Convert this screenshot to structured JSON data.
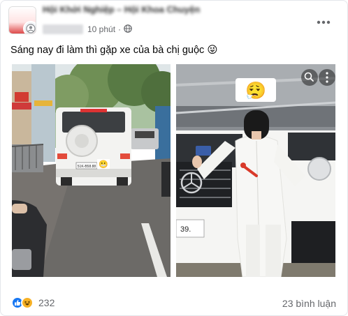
{
  "post": {
    "group_name": "Hội Khởi Nghiệp – Hội Khoa Chuyện",
    "time": "10 phút",
    "audience_icon": "globe-icon",
    "more_icon": "more-horizontal-icon",
    "caption": "Sáng nay đi làm thì gặp xe của bà chị guộc 😜",
    "photos": [
      {
        "subject": "white suv on city street",
        "plate": "51K-B58.88"
      },
      {
        "subject": "woman in white beside white suv",
        "plate": "39.",
        "overlay_emoji": "😮‍💨"
      }
    ],
    "overlay_icons": [
      "search-icon",
      "more-vertical-icon"
    ]
  },
  "footer": {
    "reaction_icons": [
      "like-icon",
      "haha-icon"
    ],
    "reaction_count": "232",
    "comment_count": "23 bình luận"
  },
  "colors": {
    "brand_blue": "#1877f2",
    "haha_yellow": "#f7b125",
    "secondary_text": "#65676b",
    "border": "#e4e6eb"
  }
}
